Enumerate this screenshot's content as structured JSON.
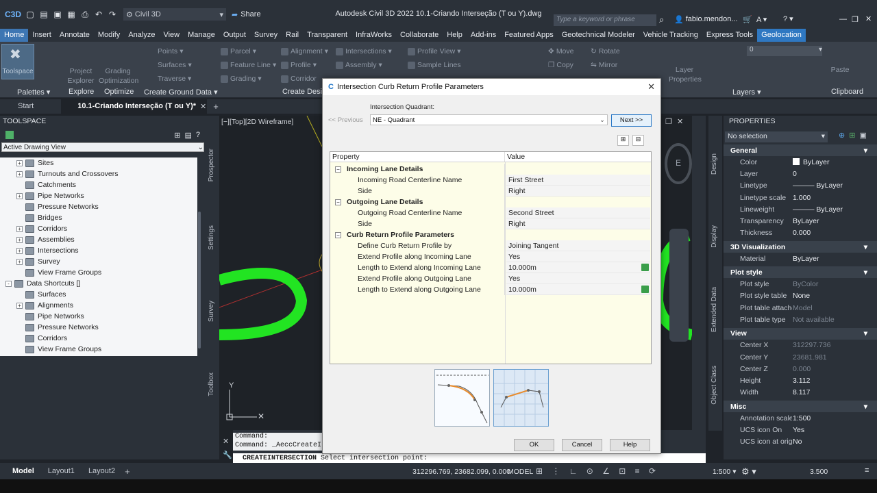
{
  "app": {
    "workspace": "Civil 3D",
    "title": "Autodesk Civil 3D 2022    10.1-Criando Interseção (T ou Y).dwg",
    "share": "Share",
    "search_placeholder": "Type a keyword or phrase",
    "user": "fabio.mendon..."
  },
  "ribbon_tabs": [
    "Home",
    "Insert",
    "Annotate",
    "Modify",
    "Analyze",
    "View",
    "Manage",
    "Output",
    "Survey",
    "Rail",
    "Transparent",
    "InfraWorks",
    "Collaborate",
    "Help",
    "Add-ins",
    "Featured Apps",
    "Geotechnical Modeler",
    "Vehicle Tracking",
    "Express Tools",
    "Geolocation"
  ],
  "ribbon": {
    "toolspace": "Toolspace",
    "project_explorer": "Project Explorer",
    "grading_optimization": "Grading Optimization",
    "points": "Points",
    "surfaces": "Surfaces",
    "traverse": "Traverse",
    "parcel": "Parcel",
    "feature_line": "Feature Line",
    "grading": "Grading",
    "alignment": "Alignment",
    "profile": "Profile",
    "corridor": "Corridor",
    "intersections": "Intersections",
    "assembly": "Assembly",
    "profile_view": "Profile View",
    "sample_lines": "Sample Lines",
    "move": "Move",
    "copy": "Copy",
    "rotate": "Rotate",
    "mirror": "Mirror",
    "layer_properties": "Layer Properties",
    "paste": "Paste",
    "layer_value": "0",
    "panels": {
      "palettes": "Palettes",
      "explore": "Explore",
      "optimize": "Optimize",
      "create_ground_data": "Create Ground Data",
      "create_design": "Create Design",
      "layers": "Layers",
      "clipboard": "Clipboard"
    }
  },
  "doc_tabs": {
    "start": "Start",
    "active": "10.1-Criando Interseção (T ou Y)*",
    "add": "+"
  },
  "toolspace": {
    "header": "TOOLSPACE",
    "view_select": "Active Drawing View",
    "tree": [
      {
        "label": "Sites",
        "indent": 1,
        "pm": "+"
      },
      {
        "label": "Turnouts and Crossovers",
        "indent": 1,
        "pm": "+"
      },
      {
        "label": "Catchments",
        "indent": 1,
        "pm": ""
      },
      {
        "label": "Pipe Networks",
        "indent": 1,
        "pm": "+"
      },
      {
        "label": "Pressure Networks",
        "indent": 1,
        "pm": ""
      },
      {
        "label": "Bridges",
        "indent": 1,
        "pm": ""
      },
      {
        "label": "Corridors",
        "indent": 1,
        "pm": "+"
      },
      {
        "label": "Assemblies",
        "indent": 1,
        "pm": "+"
      },
      {
        "label": "Intersections",
        "indent": 1,
        "pm": "+"
      },
      {
        "label": "Survey",
        "indent": 1,
        "pm": "+"
      },
      {
        "label": "View Frame Groups",
        "indent": 1,
        "pm": ""
      },
      {
        "label": "Data Shortcuts []",
        "indent": 0,
        "pm": "-"
      },
      {
        "label": "Surfaces",
        "indent": 1,
        "pm": ""
      },
      {
        "label": "Alignments",
        "indent": 1,
        "pm": "+"
      },
      {
        "label": "Pipe Networks",
        "indent": 1,
        "pm": ""
      },
      {
        "label": "Pressure Networks",
        "indent": 1,
        "pm": ""
      },
      {
        "label": "Corridors",
        "indent": 1,
        "pm": ""
      },
      {
        "label": "View Frame Groups",
        "indent": 1,
        "pm": ""
      }
    ],
    "side_tabs": [
      "Prospector",
      "Settings",
      "Survey",
      "Toolbox"
    ]
  },
  "viewport": {
    "label": "[−][Top][2D Wireframe]",
    "axis_y": "Y",
    "compass": "E"
  },
  "command": {
    "line1": "Command:",
    "line2": "Command: _AeccCreateI",
    "prompt_cmd": "CREATEINTERSECTION",
    "prompt_text": " Select intersection point:"
  },
  "dialog": {
    "title": "Intersection Curb Return Profile Parameters",
    "quadrant_label": "Intersection Quadrant:",
    "previous": "<< Previous",
    "next": "Next >>",
    "quadrant_value": "NE - Quadrant",
    "col_property": "Property",
    "col_value": "Value",
    "rows": [
      {
        "group": true,
        "label": "Incoming Lane Details"
      },
      {
        "label": "Incoming Road Centerline Name",
        "value": "First Street"
      },
      {
        "label": "Side",
        "value": "Right"
      },
      {
        "group": true,
        "label": "Outgoing Lane Details"
      },
      {
        "label": "Outgoing Road Centerline Name",
        "value": "Second Street"
      },
      {
        "label": "Side",
        "value": "Right"
      },
      {
        "group": true,
        "label": "Curb Return Profile Parameters"
      },
      {
        "label": "Define Curb Return Profile by",
        "value": "Joining Tangent"
      },
      {
        "label": "Extend Profile along Incoming Lane",
        "value": "Yes"
      },
      {
        "label": "Length to Extend along Incoming Lane",
        "value": "10.000m",
        "icon": true
      },
      {
        "label": "Extend Profile along Outgoing Lane",
        "value": "Yes"
      },
      {
        "label": "Length to Extend along Outgoing Lane",
        "value": "10.000m",
        "icon": true
      }
    ],
    "ok": "OK",
    "cancel": "Cancel",
    "help": "Help"
  },
  "properties": {
    "header": "PROPERTIES",
    "selection": "No selection",
    "side_tabs": [
      "Design",
      "Display",
      "Extended Data",
      "Object Class"
    ],
    "sections": [
      {
        "name": "General",
        "rows": [
          [
            "Color",
            "ByLayer"
          ],
          [
            "Layer",
            "0"
          ],
          [
            "Linetype",
            "——— ByLayer"
          ],
          [
            "Linetype scale",
            "1.000"
          ],
          [
            "Lineweight",
            "——— ByLayer"
          ],
          [
            "Transparency",
            "ByLayer"
          ],
          [
            "Thickness",
            "0.000"
          ]
        ]
      },
      {
        "name": "3D Visualization",
        "rows": [
          [
            "Material",
            "ByLayer"
          ]
        ]
      },
      {
        "name": "Plot style",
        "rows": [
          [
            "Plot style",
            "ByColor"
          ],
          [
            "Plot style table",
            "None"
          ],
          [
            "Plot table attached...",
            "Model"
          ],
          [
            "Plot table type",
            "Not available"
          ]
        ]
      },
      {
        "name": "View",
        "rows": [
          [
            "Center X",
            "312297.736"
          ],
          [
            "Center Y",
            "23681.981"
          ],
          [
            "Center Z",
            "0.000"
          ],
          [
            "Height",
            "3.112"
          ],
          [
            "Width",
            "8.117"
          ]
        ]
      },
      {
        "name": "Misc",
        "rows": [
          [
            "Annotation scale",
            "1:500"
          ],
          [
            "UCS icon On",
            "Yes"
          ],
          [
            "UCS icon at origin",
            "No"
          ]
        ]
      }
    ]
  },
  "status": {
    "tabs": [
      "Model",
      "Layout1",
      "Layout2"
    ],
    "add": "+",
    "coords": "312296.769, 23682.099, 0.000",
    "mode": "MODEL",
    "scale": "1:500",
    "zoom": "3.500"
  },
  "colors": {
    "accent": "#3d76b3",
    "geolocation": "#2f78c2",
    "green": "#22e422"
  }
}
